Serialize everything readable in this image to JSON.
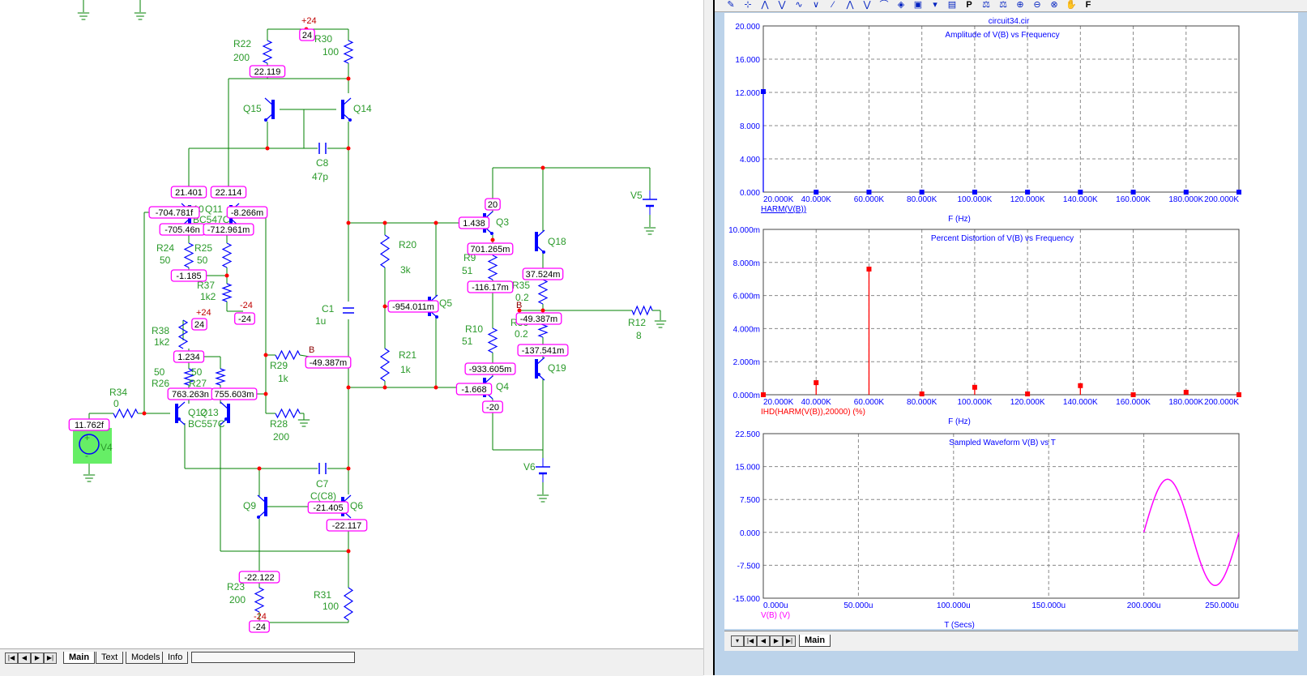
{
  "schematic": {
    "components": [
      {
        "ref": "R22",
        "value": "200"
      },
      {
        "ref": "R30",
        "value": "100"
      },
      {
        "ref": "Q15"
      },
      {
        "ref": "Q14"
      },
      {
        "ref": "C8",
        "value": "47p"
      },
      {
        "ref": "Q10",
        "value": "BC547C"
      },
      {
        "ref": "Q11"
      },
      {
        "ref": "R24",
        "value": "50"
      },
      {
        "ref": "R25",
        "value": "50"
      },
      {
        "ref": "R37",
        "value": "1k2"
      },
      {
        "ref": "R38",
        "value": "1k2"
      },
      {
        "ref": "R26",
        "value": "50"
      },
      {
        "ref": "R27",
        "value": "50"
      },
      {
        "ref": "Q12",
        "value": "BC557C"
      },
      {
        "ref": "Q13"
      },
      {
        "ref": "R34",
        "value": "0"
      },
      {
        "ref": "V4"
      },
      {
        "ref": "R29",
        "value": "1k"
      },
      {
        "ref": "R28",
        "value": "200"
      },
      {
        "ref": "C1",
        "value": "1u"
      },
      {
        "ref": "R20",
        "value": "3k"
      },
      {
        "ref": "R21",
        "value": "1k"
      },
      {
        "ref": "Q5"
      },
      {
        "ref": "C7",
        "value": "C(C8)"
      },
      {
        "ref": "Q9"
      },
      {
        "ref": "Q6"
      },
      {
        "ref": "R23",
        "value": "200"
      },
      {
        "ref": "R31",
        "value": "100"
      },
      {
        "ref": "Q3"
      },
      {
        "ref": "Q18"
      },
      {
        "ref": "R9",
        "value": "51"
      },
      {
        "ref": "R10",
        "value": "51"
      },
      {
        "ref": "R35",
        "value": "0.2"
      },
      {
        "ref": "R36",
        "value": "0.2"
      },
      {
        "ref": "Q4"
      },
      {
        "ref": "Q19"
      },
      {
        "ref": "V5"
      },
      {
        "ref": "V6"
      },
      {
        "ref": "R12",
        "value": "8"
      }
    ],
    "node_voltages": [
      "24",
      "22.119",
      "21.401",
      "22.114",
      "-704.781f",
      "-8.266m",
      "-705.46n",
      "-712.961m",
      "-1.185",
      "-24",
      "24",
      "1.234",
      "763.263n",
      "755.603m",
      "11.762f",
      "-49.387m",
      "-954.011m",
      "20",
      "1.438",
      "701.265m",
      "-116.17m",
      "37.524m",
      "-49.387m",
      "-137.541m",
      "-933.605m",
      "-1.668",
      "-20",
      "-21.405",
      "-22.117",
      "-22.122",
      "-24"
    ],
    "power_labels": [
      "+24",
      "+24",
      "-24",
      "-24"
    ],
    "node_names": [
      "B",
      "B"
    ],
    "colors": {
      "wire": "#008000",
      "component": "#0000ff",
      "node_box": "#ff00ff",
      "junction": "#ff0000",
      "selected": "#66ee66"
    }
  },
  "bottom_tabs": [
    "Main",
    "Text",
    "Models",
    "Info"
  ],
  "plot_window": {
    "toolbar_icons": [
      "edit-icon",
      "cursor-icon",
      "peak-icon",
      "valley-icon",
      "high-icon",
      "low-icon",
      "inflection-icon",
      "global-high-icon",
      "global-low-icon",
      "slope-icon",
      "tag-icon",
      "3d-icon",
      "dropdown-icon",
      "table-icon",
      "p-icon",
      "scale-icon",
      "scale2-icon",
      "zoom-in-icon",
      "zoom-out-icon",
      "zoom-box-icon",
      "pan-icon",
      "f-icon"
    ],
    "filename": "circuit34.cir",
    "tabs": [
      "Main"
    ]
  },
  "chart_data": [
    {
      "type": "bar",
      "title": "Amplitude of V(B) vs Frequency",
      "xlabel": "F (Hz)",
      "series": [
        {
          "name": "HARM(V(B))",
          "color": "#0000ff",
          "x": [
            20000,
            40000,
            60000,
            80000,
            100000,
            120000,
            140000,
            160000,
            180000,
            200000
          ],
          "y": [
            12.1,
            0,
            0,
            0,
            0,
            0,
            0,
            0,
            0,
            0
          ]
        }
      ],
      "xlim": [
        20000,
        200000
      ],
      "ylim": [
        0,
        20
      ],
      "xticks": [
        "20.000K",
        "40.000K",
        "60.000K",
        "80.000K",
        "100.000K",
        "120.000K",
        "140.000K",
        "160.000K",
        "180.000K",
        "200.000K"
      ],
      "yticks": [
        "0.000",
        "4.000",
        "8.000",
        "12.000",
        "16.000",
        "20.000"
      ],
      "grid": true
    },
    {
      "type": "bar",
      "title": "Percent Distortion of V(B) vs Frequency",
      "xlabel": "F (Hz)",
      "series": [
        {
          "name": "IHD(HARM(V(B)),20000) (%)",
          "color": "#ff0000",
          "x": [
            20000,
            40000,
            60000,
            80000,
            100000,
            120000,
            140000,
            160000,
            180000,
            200000
          ],
          "y": [
            0,
            0.00073,
            0.0076,
            5e-05,
            0.00045,
            5e-05,
            0.00055,
            0,
            0.00015,
            0
          ]
        }
      ],
      "xlim": [
        20000,
        200000
      ],
      "ylim": [
        0,
        0.01
      ],
      "xticks": [
        "20.000K",
        "40.000K",
        "60.000K",
        "80.000K",
        "100.000K",
        "120.000K",
        "140.000K",
        "160.000K",
        "180.000K",
        "200.000K"
      ],
      "yticks": [
        "0.000m",
        "2.000m",
        "4.000m",
        "6.000m",
        "8.000m",
        "10.000m"
      ],
      "grid": true
    },
    {
      "type": "line",
      "title": "Sampled Waveform  V(B) vs T",
      "xlabel": "T (Secs)",
      "series": [
        {
          "name": "V(B) (V)",
          "color": "#ff00ff",
          "function": "12.1*sin(2*pi*20000*(t-200u))",
          "t_range": [
            0.0002,
            0.00025
          ]
        }
      ],
      "xlim": [
        0,
        0.00025
      ],
      "ylim": [
        -15,
        22.5
      ],
      "xticks": [
        "0.000u",
        "50.000u",
        "100.000u",
        "150.000u",
        "200.000u",
        "250.000u"
      ],
      "yticks": [
        "-15.000",
        "-7.500",
        "0.000",
        "7.500",
        "15.000",
        "22.500"
      ],
      "grid": true
    }
  ]
}
